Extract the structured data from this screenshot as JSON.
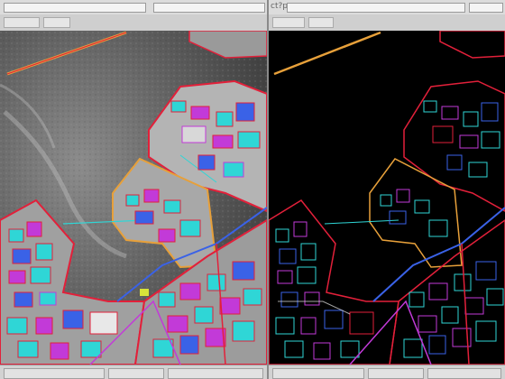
{
  "left_window": {
    "title": "",
    "image_type": "grayscale-aerial-photo-with-colored-vector-overlay",
    "status_fields": [
      "",
      "",
      ""
    ]
  },
  "right_window": {
    "title": "ct?p",
    "image_type": "edge-detection-on-black-with-colored-vector-overlay",
    "status_fields": [
      "",
      "",
      ""
    ]
  },
  "colors": {
    "chrome": "#d4d4d4",
    "overlay_red": "#e2203a",
    "overlay_cyan": "#2fd6d6",
    "overlay_magenta": "#c23ad8",
    "overlay_orange": "#e7a03a",
    "overlay_blue": "#3a62e7",
    "left_background": "#6f6f6f",
    "right_background": "#000000"
  },
  "icons": [
    "window-title-field",
    "toolbar-menu",
    "status-cell"
  ]
}
